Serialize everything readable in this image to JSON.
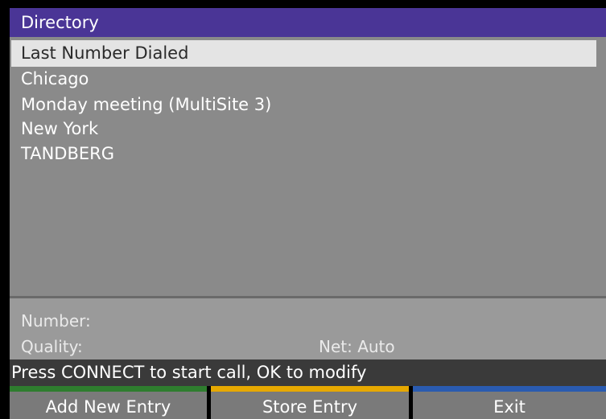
{
  "title": "Directory",
  "entries": [
    {
      "label": "Last Number Dialed",
      "selected": true
    },
    {
      "label": "Chicago",
      "selected": false
    },
    {
      "label": "Monday meeting (MultiSite 3)",
      "selected": false
    },
    {
      "label": "New York",
      "selected": false
    },
    {
      "label": "TANDBERG",
      "selected": false
    }
  ],
  "info": {
    "number_label": "Number:",
    "quality_label": "Quality:",
    "net_text": "Net: Auto"
  },
  "status": "Press CONNECT to start call, OK to modify",
  "softkeys": [
    {
      "label": "Add New Entry",
      "color": "#2e7d2e"
    },
    {
      "label": "Store Entry",
      "color": "#e6a800"
    },
    {
      "label": "Exit",
      "color": "#2a5bb0"
    }
  ],
  "colors": {
    "title_bar": "#4a3596",
    "list_background": "#8a8a8a",
    "selection": "#e4e4e4"
  }
}
